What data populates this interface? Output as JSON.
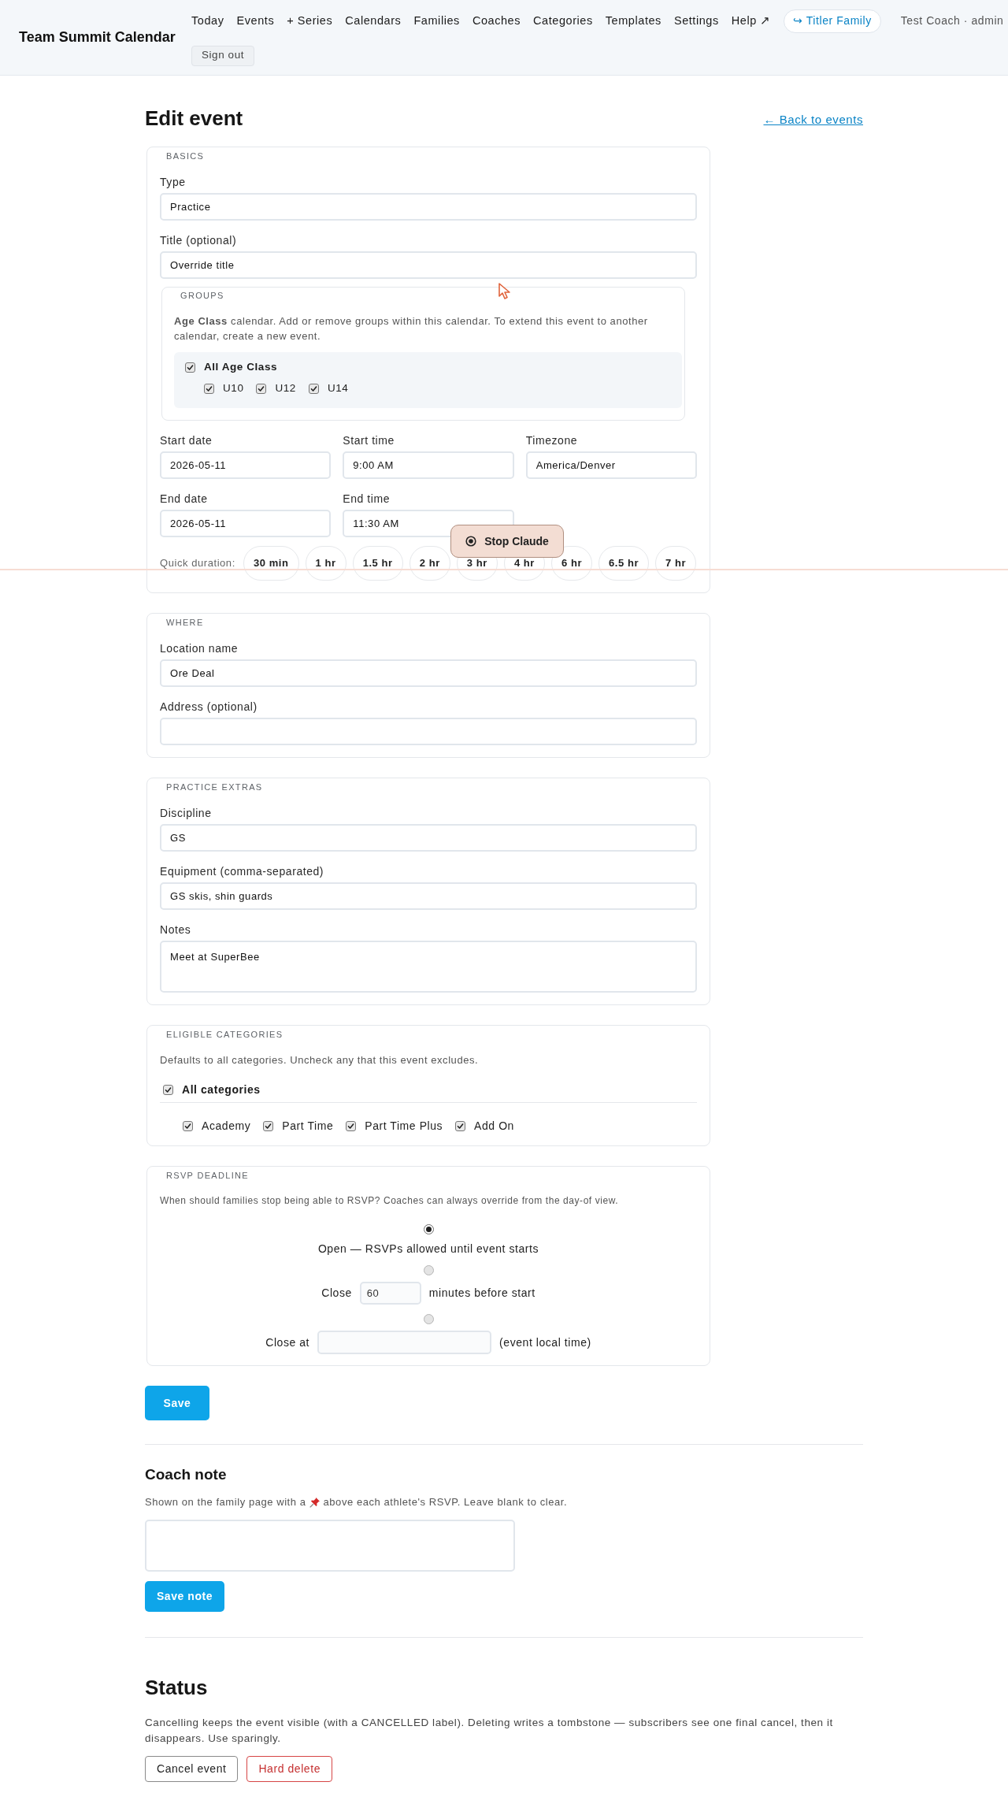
{
  "header": {
    "title": "Team Summit Calendar",
    "nav": [
      "Today",
      "Events",
      "+ Series",
      "Calendars",
      "Families",
      "Coaches",
      "Categories",
      "Templates",
      "Settings",
      "Help ↗"
    ],
    "family_switch": "↪ Titler Family",
    "user": "Test Coach · admin",
    "sign_out": "Sign out"
  },
  "page": {
    "title": "Edit event",
    "back_link": "← Back to events"
  },
  "basics": {
    "legend": "BASICS",
    "fields": [
      {
        "label": "Type",
        "value": "Practice"
      },
      {
        "label": "Title (optional)",
        "value": "Override title"
      }
    ],
    "groups": {
      "legend": "GROUPS",
      "description": "**Age Class** calendar. Add or remove groups within this calendar. To extend this event to another calendar, create a new event.",
      "all": {
        "label": "All Age Class",
        "checked": true
      },
      "items": [
        {
          "label": "U10",
          "checked": true
        },
        {
          "label": "U12",
          "checked": true
        },
        {
          "label": "U14",
          "checked": true
        }
      ]
    },
    "schedule": [
      {
        "label": "Start date",
        "value": "2026-05-11"
      },
      {
        "label": "Start time",
        "value": "9:00 AM"
      },
      {
        "label": "Timezone",
        "value": "America/Denver"
      },
      {
        "label": "End date",
        "value": "2026-05-11"
      },
      {
        "label": "End time",
        "value": "11:30 AM"
      }
    ],
    "quick_duration": {
      "label": "Quick duration:",
      "options": [
        "30 min",
        "1 hr",
        "1.5 hr",
        "2 hr",
        "3 hr",
        "4 hr",
        "6 hr",
        "6.5 hr",
        "7 hr"
      ]
    }
  },
  "where": {
    "legend": "WHERE",
    "fields": [
      {
        "label": "Location name",
        "value": "Ore Deal"
      },
      {
        "label": "Address (optional)"
      }
    ]
  },
  "practice_extras": {
    "legend": "PRACTICE EXTRAS",
    "fields": [
      {
        "kind": "input",
        "label": "Discipline",
        "value": "GS"
      },
      {
        "kind": "input",
        "label": "Equipment (comma-separated)",
        "value": "GS skis, shin guards"
      },
      {
        "kind": "textarea",
        "label": "Notes",
        "value": "Meet at SuperBee"
      }
    ]
  },
  "eligible_categories": {
    "legend": "ELIGIBLE CATEGORIES",
    "description": "Defaults to all categories. Uncheck any that this event excludes.",
    "all": {
      "label": "All categories",
      "checked": true
    },
    "items": [
      {
        "label": "Academy",
        "checked": true
      },
      {
        "label": "Part Time",
        "checked": true
      },
      {
        "label": "Part Time Plus",
        "checked": true
      },
      {
        "label": "Add On",
        "checked": true
      }
    ]
  },
  "rsvp_deadline": {
    "legend": "RSVP DEADLINE",
    "description": "When should families stop being able to RSVP? Coaches can always override from the day-of view.",
    "options": [
      {
        "kind": "open",
        "selected": true,
        "label": "Open — RSVPs allowed until event starts"
      },
      {
        "kind": "minutes",
        "selected": false,
        "prefix": "Close",
        "value": "60",
        "suffix": "minutes before start"
      },
      {
        "kind": "datetime",
        "selected": false,
        "prefix": "Close at",
        "suffix": "(event local time)"
      }
    ]
  },
  "save_button": "Save",
  "coach_note": {
    "title": "Coach note",
    "description_parts": [
      "Shown on the family page with a",
      "above each athlete's RSVP. Leave blank to clear."
    ],
    "button": "Save note"
  },
  "status": {
    "title": "Status",
    "description": "Cancelling keeps the event visible (with a CANCELLED label). Deleting writes a tombstone — subscribers see one final cancel, then it disappears. Use sparingly.",
    "buttons": [
      {
        "kind": "neutral",
        "label": "Cancel event"
      },
      {
        "kind": "danger",
        "label": "Hard delete"
      }
    ]
  },
  "agent_overlay": {
    "button": "Stop Claude"
  }
}
